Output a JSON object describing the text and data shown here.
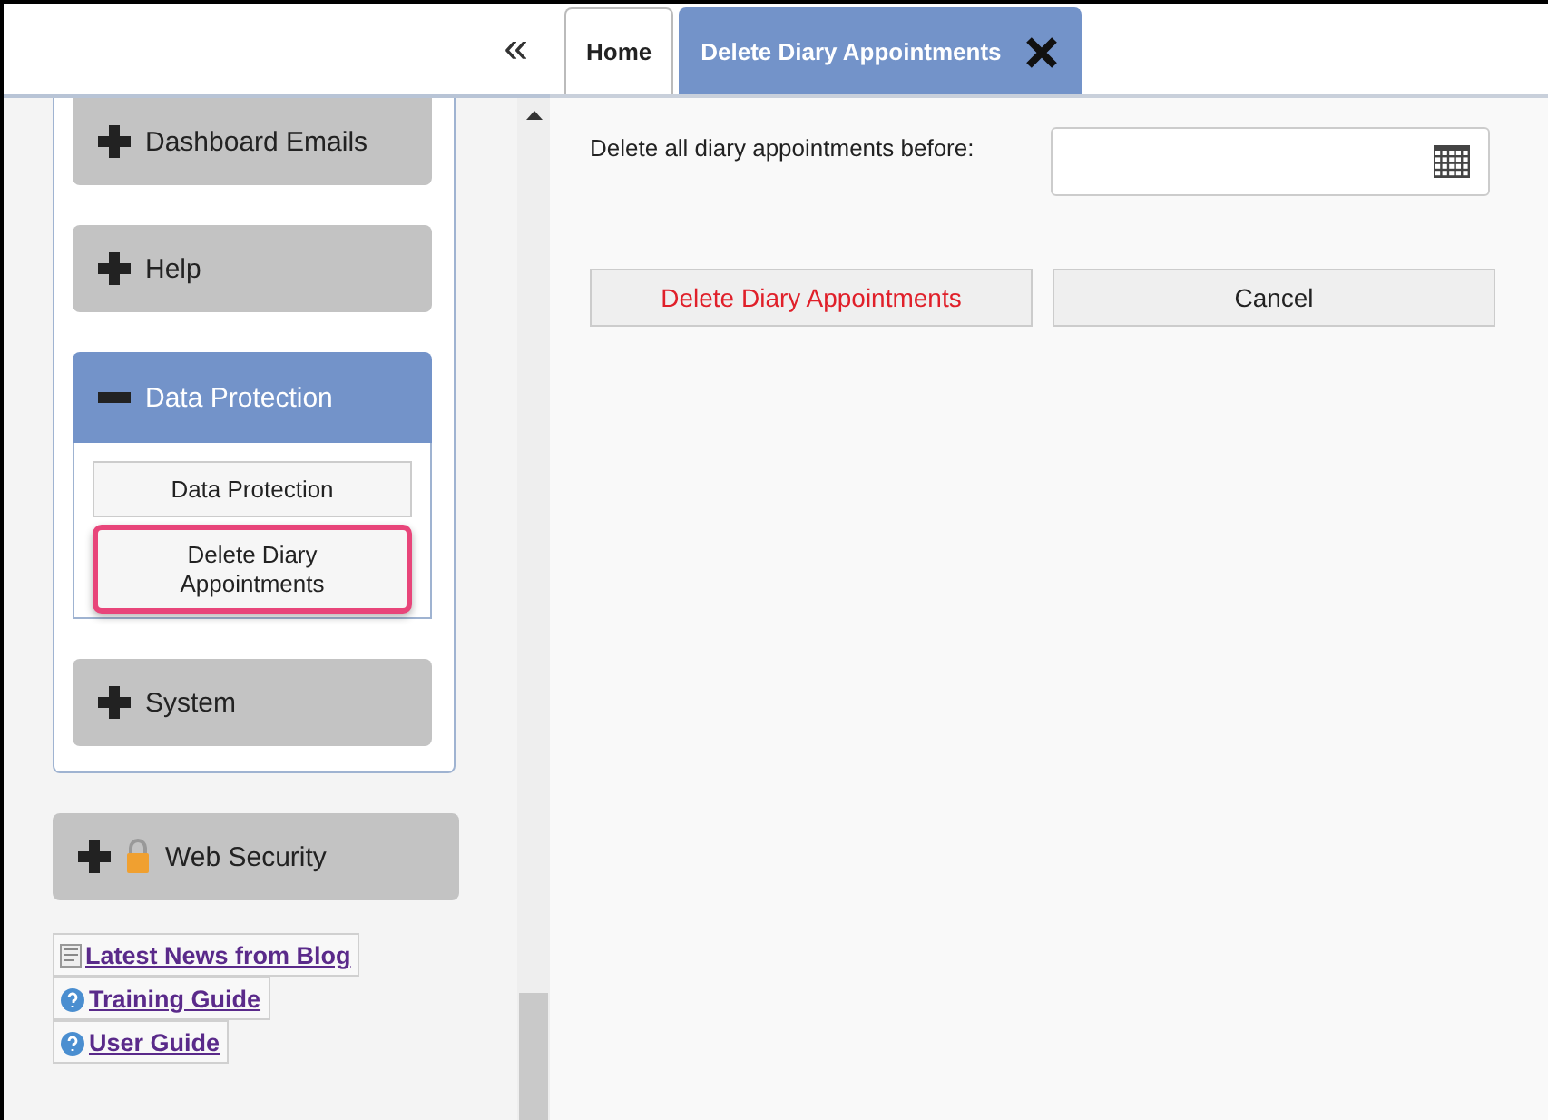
{
  "sidebar": {
    "collapse_glyph": "«",
    "sections": [
      {
        "label": "Dashboard Emails",
        "expanded": false,
        "locked": false
      },
      {
        "label": "Help",
        "expanded": false,
        "locked": false
      },
      {
        "label": "Data Protection",
        "expanded": true,
        "locked": false,
        "items": [
          {
            "label": "Data Protection",
            "highlighted": false
          },
          {
            "label": "Delete Diary Appointments",
            "highlighted": true
          }
        ]
      },
      {
        "label": "System",
        "expanded": false,
        "locked": false
      }
    ],
    "outer_sections": [
      {
        "label": "Web Security",
        "expanded": false,
        "locked": true
      }
    ],
    "links": [
      {
        "label": "Latest News from Blog",
        "kind": "news"
      },
      {
        "label": "Training Guide",
        "kind": "help"
      },
      {
        "label": "User Guide",
        "kind": "help"
      }
    ]
  },
  "tabs": [
    {
      "label": "Home",
      "selected": false,
      "closable": false
    },
    {
      "label": "Delete Diary Appointments",
      "selected": true,
      "closable": true
    }
  ],
  "form": {
    "label": "Delete all diary appointments before:"
  },
  "buttons": [
    {
      "label": "Delete Diary Appointments",
      "kind": "danger"
    },
    {
      "label": "Cancel",
      "kind": "normal"
    }
  ]
}
